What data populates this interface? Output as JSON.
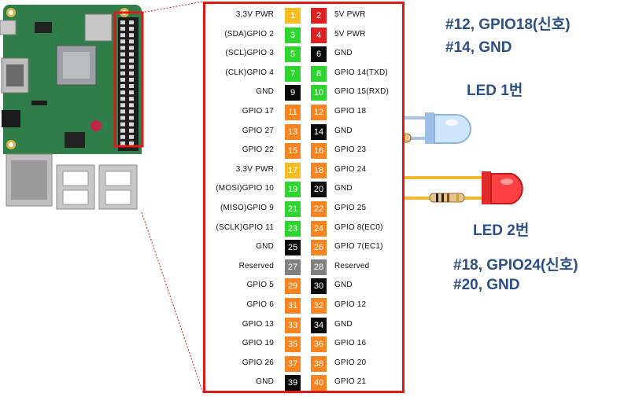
{
  "colors": {
    "power33": "#f5bd1f",
    "power5": "#e02020",
    "gpio_green": "#2fd52f",
    "gnd": "#0a0a0a",
    "gpio_orange": "#f7841e",
    "reserved": "#808080",
    "frame": "#e01818",
    "note_text": "#2b4f87",
    "wire_blue": "#a9c3e3",
    "wire_yellow": "#f2b92c",
    "led_blue": "#bfe0ff",
    "led_red": "#ff3a3a"
  },
  "pins": [
    {
      "left": "3,3V PWR",
      "ln": "1",
      "lc": "power33",
      "rn": "2",
      "rc": "power5",
      "right": "5V PWR"
    },
    {
      "left": "(SDA)GPIO 2",
      "ln": "3",
      "lc": "gpio_green",
      "rn": "4",
      "rc": "power5",
      "right": "5V PWR"
    },
    {
      "left": "(SCL)GPIO 3",
      "ln": "5",
      "lc": "gpio_green",
      "rn": "6",
      "rc": "gnd",
      "right": "GND"
    },
    {
      "left": "(CLK)GPIO 4",
      "ln": "7",
      "lc": "gpio_green",
      "rn": "8",
      "rc": "gpio_green",
      "right": "GPIO 14(TXD)"
    },
    {
      "left": "GND",
      "ln": "9",
      "lc": "gnd",
      "rn": "10",
      "rc": "gpio_green",
      "right": "GPIO 15(RXD)"
    },
    {
      "left": "GPIO 17",
      "ln": "11",
      "lc": "gpio_orange",
      "rn": "12",
      "rc": "gpio_orange",
      "right": "GPIO 18"
    },
    {
      "left": "GPIO 27",
      "ln": "13",
      "lc": "gpio_orange",
      "rn": "14",
      "rc": "gnd",
      "right": "GND"
    },
    {
      "left": "GPIO 22",
      "ln": "15",
      "lc": "gpio_orange",
      "rn": "16",
      "rc": "gpio_orange",
      "right": "GPIO 23"
    },
    {
      "left": "3,3V PWR",
      "ln": "17",
      "lc": "power33",
      "rn": "18",
      "rc": "gpio_orange",
      "right": "GPIO 24"
    },
    {
      "left": "(MOSI)GPIO 10",
      "ln": "19",
      "lc": "gpio_green",
      "rn": "20",
      "rc": "gnd",
      "right": "GND"
    },
    {
      "left": "(MISO)GPIO 9",
      "ln": "21",
      "lc": "gpio_green",
      "rn": "22",
      "rc": "gpio_orange",
      "right": "GPIO 25"
    },
    {
      "left": "(SCLK)GPIO 11",
      "ln": "23",
      "lc": "gpio_green",
      "rn": "24",
      "rc": "gpio_orange",
      "right": "GPIO 8(EC0)"
    },
    {
      "left": "GND",
      "ln": "25",
      "lc": "gnd",
      "rn": "26",
      "rc": "gpio_orange",
      "right": "GPIO 7(EC1)"
    },
    {
      "left": "Reserved",
      "ln": "27",
      "lc": "reserved",
      "rn": "28",
      "rc": "reserved",
      "right": "Reserved"
    },
    {
      "left": "GPIO 5",
      "ln": "29",
      "lc": "gpio_orange",
      "rn": "30",
      "rc": "gnd",
      "right": "GND"
    },
    {
      "left": "GPIO 6",
      "ln": "31",
      "lc": "gpio_orange",
      "rn": "32",
      "rc": "gpio_orange",
      "right": "GPIO 12"
    },
    {
      "left": "GPIO 13",
      "ln": "33",
      "lc": "gpio_orange",
      "rn": "34",
      "rc": "gnd",
      "right": "GND"
    },
    {
      "left": "GPIO 19",
      "ln": "35",
      "lc": "gpio_orange",
      "rn": "36",
      "rc": "gpio_orange",
      "right": "GPIO 16"
    },
    {
      "left": "GPIO 26",
      "ln": "37",
      "lc": "gpio_orange",
      "rn": "38",
      "rc": "gpio_orange",
      "right": "GPIO 20"
    },
    {
      "left": "GND",
      "ln": "39",
      "lc": "gnd",
      "rn": "40",
      "rc": "gpio_orange",
      "right": "GPIO 21"
    }
  ],
  "notes": {
    "led1_pins_line1": "#12, GPIO18(신호)",
    "led1_pins_line2": "#14, GND",
    "led1_label": "LED 1번",
    "led2_label": "LED 2번",
    "led2_pins_line1": "#18, GPIO24(신호)",
    "led2_pins_line2": "#20, GND"
  }
}
